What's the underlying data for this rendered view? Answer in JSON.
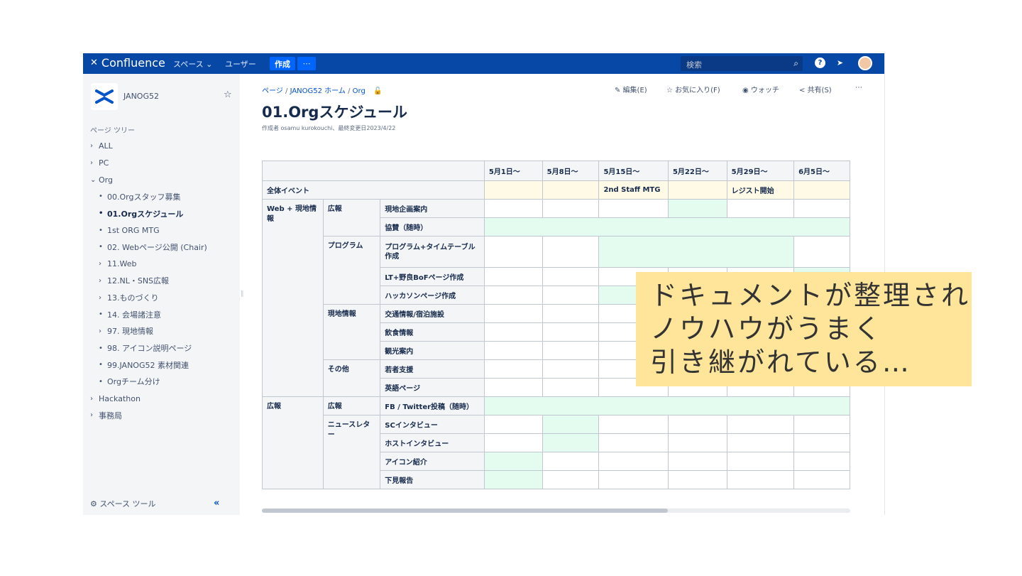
{
  "topbar": {
    "logo": "Confluence",
    "nav_spaces": "スペース ⌄",
    "nav_users": "ユーザー",
    "create": "作成",
    "more": "⋯",
    "search_placeholder": "検索"
  },
  "sidebar": {
    "space_name": "JANOG52",
    "tree_title": "ページ ツリー",
    "items": [
      {
        "label": "ALL",
        "kind": "collapsed"
      },
      {
        "label": "PC",
        "kind": "collapsed"
      },
      {
        "label": "Org",
        "kind": "expanded"
      },
      {
        "label": "00.Orgスタッフ募集",
        "kind": "leaf"
      },
      {
        "label": "01.Orgスケジュール",
        "kind": "leaf-active"
      },
      {
        "label": "1st ORG MTG",
        "kind": "leaf"
      },
      {
        "label": "02. Webページ公開 (Chair)",
        "kind": "leaf"
      },
      {
        "label": "11.Web",
        "kind": "child-collapsed"
      },
      {
        "label": "12.NL・SNS広報",
        "kind": "child-collapsed"
      },
      {
        "label": "13.ものづくり",
        "kind": "child-collapsed"
      },
      {
        "label": "14. 会場諸注意",
        "kind": "leaf"
      },
      {
        "label": "97. 現地情報",
        "kind": "child-collapsed"
      },
      {
        "label": "98. アイコン説明ページ",
        "kind": "leaf"
      },
      {
        "label": "99.JANOG52 素材関連",
        "kind": "leaf"
      },
      {
        "label": "Orgチーム分け",
        "kind": "leaf"
      },
      {
        "label": "Hackathon",
        "kind": "collapsed"
      },
      {
        "label": "事務局",
        "kind": "collapsed"
      }
    ],
    "space_tools": "スペース ツール",
    "collapse": "«"
  },
  "page": {
    "breadcrumb": [
      "ページ",
      "JANOG52 ホーム",
      "Org"
    ],
    "actions": {
      "edit": "編集(E)",
      "favorite": "お気に入り(F)",
      "watch": "ウォッチ",
      "share": "共有(S)",
      "more": "⋯"
    },
    "title": "01.Orgスケジュール",
    "meta": "作成者 osamu kurokouchi、最終変更日2023/4/22"
  },
  "table": {
    "headers": [
      "5月1日〜",
      "5月8日〜",
      "5月15日〜",
      "5月22日〜",
      "5月29日〜",
      "6月5日〜"
    ],
    "event_row_label": "全体イベント",
    "event_cells": [
      "",
      "",
      "2nd Staff MTG",
      "",
      "レジスト開始",
      ""
    ],
    "groups": {
      "web_local": "Web + 現地情報",
      "pr": "広報",
      "program": "プログラム",
      "local_info": "現地情報",
      "other": "その他",
      "pr2": "広報",
      "pr2_sub": "広報",
      "newsletter": "ニュースレター"
    },
    "tasks": {
      "t1": "現地企画案内",
      "t2": "協賛（随時）",
      "t3": "プログラム+タイムテーブル作成",
      "t4": "LT+野良BoFページ作成",
      "t5": "ハッカソンページ作成",
      "t6": "交通情報/宿泊施設",
      "t7": "飲食情報",
      "t8": "観光案内",
      "t9": "若者支援",
      "t10": "英語ページ",
      "t11": "FB / Twitter投稿（随時）",
      "t12": "SCインタビュー",
      "t13": "ホストインタビュー",
      "t14": "アイコン紹介",
      "t15": "下見報告"
    }
  },
  "caption": {
    "line1": "ドキュメントが整理され",
    "line2": "ノウハウがうまく",
    "line3": "引き継がれている…"
  },
  "colors": {
    "topbar": "#0747a6",
    "event_fill": "#fffae6",
    "schedule_fill": "#e3fcef",
    "caption_bg": "#ffe599"
  }
}
